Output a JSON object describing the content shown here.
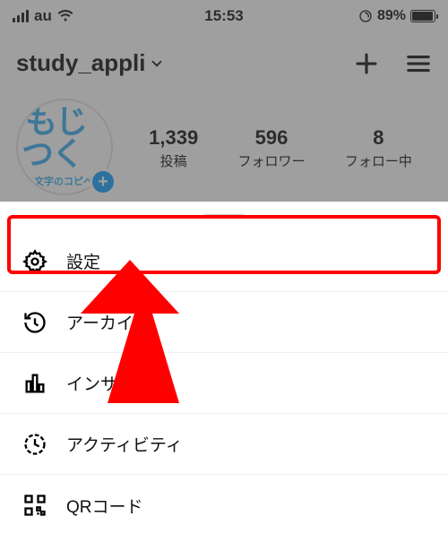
{
  "status": {
    "carrier": "au",
    "time": "15:53",
    "battery_pct": "89%"
  },
  "profile": {
    "username": "study_appli",
    "avatar_line1": "もじ",
    "avatar_line2": "つく",
    "avatar_sub": "文字のコピペ",
    "stats": [
      {
        "value": "1,339",
        "label": "投稿"
      },
      {
        "value": "596",
        "label": "フォロワー"
      },
      {
        "value": "8",
        "label": "フォロー中"
      }
    ]
  },
  "menu": {
    "items": [
      {
        "icon": "gear-icon",
        "label": "設定"
      },
      {
        "icon": "history-icon",
        "label": "アーカイブ"
      },
      {
        "icon": "chart-icon",
        "label": "インサイト"
      },
      {
        "icon": "activity-icon",
        "label": "アクティビティ"
      },
      {
        "icon": "qr-icon",
        "label": "QRコード"
      }
    ]
  }
}
